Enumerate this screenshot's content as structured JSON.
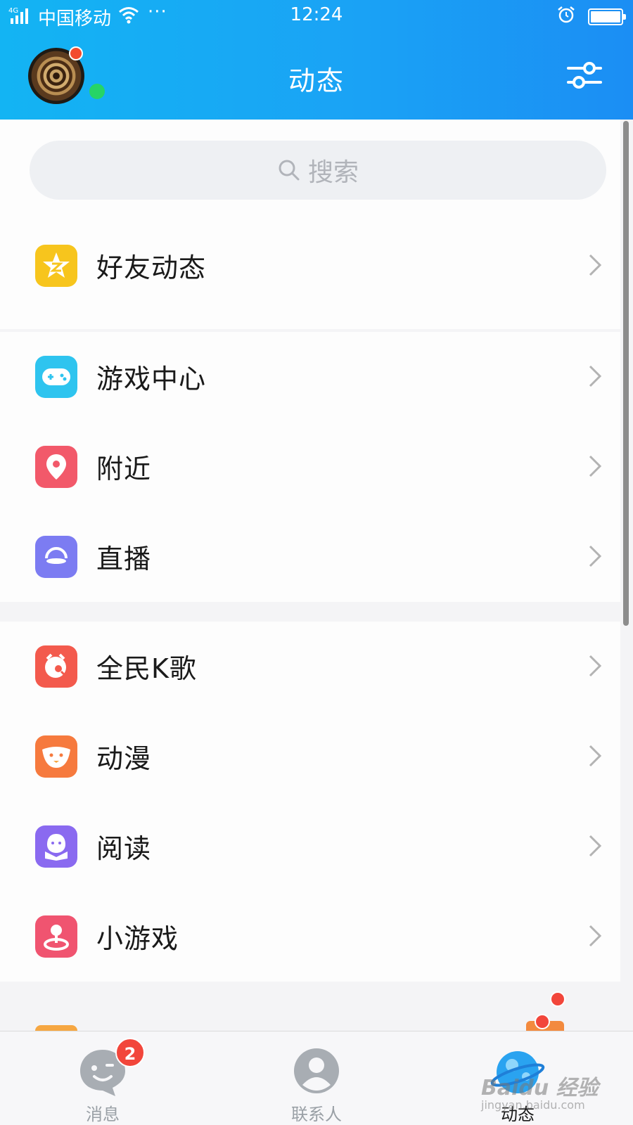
{
  "status_bar": {
    "network": "4G",
    "carrier": "中国移动",
    "more": "···",
    "time": "12:24",
    "battery_level": 1.0
  },
  "header": {
    "title": "动态",
    "avatar_badge": true,
    "online_status": "online"
  },
  "search": {
    "placeholder": "搜索"
  },
  "groups": [
    {
      "items": [
        {
          "label": "好友动态",
          "icon": "qzone-star-icon",
          "color": "#f7c51d"
        }
      ]
    },
    {
      "items": [
        {
          "label": "游戏中心",
          "icon": "gamepad-icon",
          "color": "#2ec4ef"
        },
        {
          "label": "附近",
          "icon": "location-pin-icon",
          "color": "#f2596a"
        },
        {
          "label": "直播",
          "icon": "live-icon",
          "color": "#7c7cf2"
        }
      ]
    },
    {
      "items": [
        {
          "label": "全民K歌",
          "icon": "karaoke-icon",
          "color": "#f35a4d"
        },
        {
          "label": "动漫",
          "icon": "anime-icon",
          "color": "#f67a3e"
        },
        {
          "label": "阅读",
          "icon": "reading-icon",
          "color": "#8a6af0"
        },
        {
          "label": "小游戏",
          "icon": "mini-game-icon",
          "color": "#f05470"
        }
      ]
    }
  ],
  "bottom_nav": [
    {
      "label": "消息",
      "icon": "message-icon",
      "badge": "2",
      "active": false
    },
    {
      "label": "联系人",
      "icon": "contacts-icon",
      "active": false
    },
    {
      "label": "动态",
      "icon": "planet-icon",
      "active": true,
      "red_dot": true
    }
  ],
  "watermark": {
    "brand": "Baidu 经验",
    "url": "jingyan.baidu.com"
  },
  "colors": {
    "header_start": "#13b4f3",
    "header_end": "#1b8ef4",
    "badge_red": "#f2463b",
    "online_green": "#26d466"
  }
}
